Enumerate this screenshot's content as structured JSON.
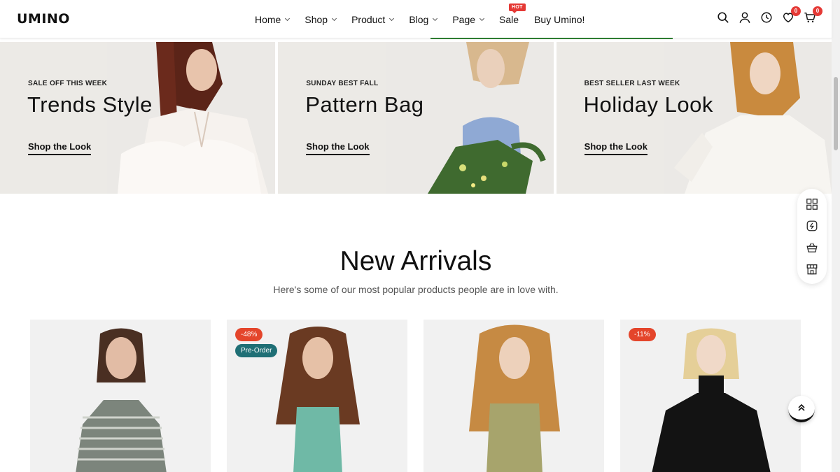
{
  "header": {
    "logo": "UMINO",
    "nav": [
      {
        "label": "Home",
        "dropdown": true
      },
      {
        "label": "Shop",
        "dropdown": true
      },
      {
        "label": "Product",
        "dropdown": true
      },
      {
        "label": "Blog",
        "dropdown": true
      },
      {
        "label": "Page",
        "dropdown": true
      },
      {
        "label": "Sale",
        "dropdown": false,
        "badge": "HOT"
      },
      {
        "label": "Buy Umino!",
        "dropdown": false
      }
    ],
    "icons": [
      "search-icon",
      "user-icon",
      "history-icon",
      "heart-icon",
      "cart-icon"
    ],
    "wishlist_count": "0",
    "cart_count": "0"
  },
  "banners": [
    {
      "subtitle": "SALE OFF THIS WEEK",
      "title": "Trends Style",
      "cta": "Shop the Look"
    },
    {
      "subtitle": "SUNDAY BEST FALL",
      "title": "Pattern Bag",
      "cta": "Shop the Look"
    },
    {
      "subtitle": "BEST SELLER LAST WEEK",
      "title": "Holiday Look",
      "cta": "Shop the Look"
    }
  ],
  "section": {
    "title": "New Arrivals",
    "subtitle": "Here's some of our most popular products people are in love with."
  },
  "products": [
    {
      "badges": []
    },
    {
      "badges": [
        "-48%",
        "Pre-Order"
      ]
    },
    {
      "badges": []
    },
    {
      "badges": [
        "-11%"
      ]
    }
  ],
  "side_tools": [
    "grid-icon",
    "compare-icon",
    "basket-icon",
    "store-icon"
  ],
  "back_to_top": "back-to-top-icon",
  "colors": {
    "accent": "#e53935",
    "sale_badge": "#e4452b",
    "preorder_badge": "#1f6f75",
    "banner_bg": "#eceae6",
    "card_bg": "#f1f1f1"
  }
}
